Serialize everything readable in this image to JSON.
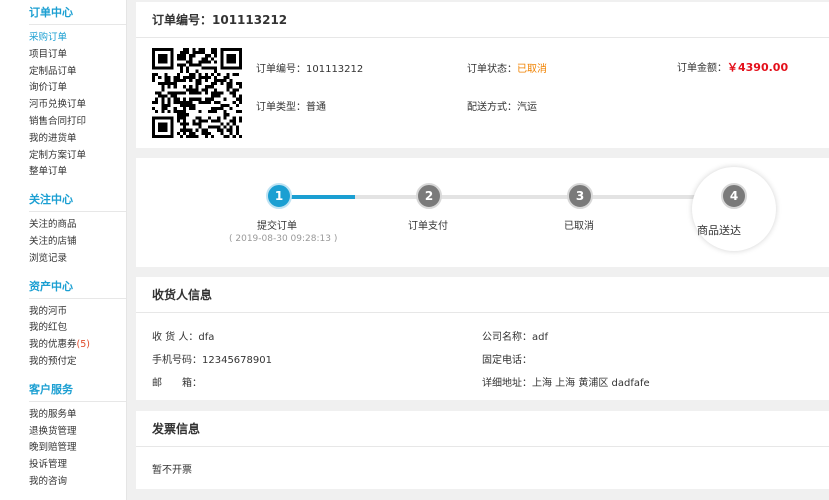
{
  "sidebar": {
    "sections": [
      {
        "title": "订单中心",
        "items": [
          "采购订单",
          "项目订单",
          "定制品订单",
          "询价订单",
          "河币兑换订单",
          "销售合同打印",
          "我的进货单",
          "定制方案订单",
          "整单订单"
        ]
      },
      {
        "title": "关注中心",
        "items": [
          "关注的商品",
          "关注的店铺",
          "浏览记录"
        ]
      },
      {
        "title": "资产中心",
        "items": [
          "我的河币",
          "我的红包",
          "我的优惠券",
          "我的预付定"
        ],
        "coupon_count": "(5)"
      },
      {
        "title": "客户服务",
        "items": [
          "我的服务单",
          "退换货管理",
          "晚到赔管理",
          "投诉管理",
          "我的咨询"
        ]
      }
    ]
  },
  "order": {
    "header": "订单编号：101113212",
    "no_label": "订单编号：",
    "no_value": "101113212",
    "status_label": "订单状态：",
    "status_value": "已取消",
    "amount_label": "订单金额：",
    "amount_value": "￥4390.00",
    "type_label": "订单类型：",
    "type_value": "普通",
    "ship_label": "配送方式：",
    "ship_value": "汽运"
  },
  "progress": {
    "steps": [
      {
        "num": "1",
        "label": "提交订单",
        "time": "( 2019-08-30 09:28:13 )"
      },
      {
        "num": "2",
        "label": "订单支付"
      },
      {
        "num": "3",
        "label": "已取消"
      },
      {
        "num": "4",
        "label": "商品送达"
      }
    ]
  },
  "receiver": {
    "title": "收货人信息",
    "name_label": "收 货 人：",
    "name_value": "dfa",
    "phone_label": "手机号码：",
    "phone_value": "12345678901",
    "email_label": "邮　　箱：",
    "email_value": "",
    "company_label": "公司名称：",
    "company_value": "adf",
    "tel_label": "固定电话：",
    "tel_value": "",
    "addr_label": "详细地址：",
    "addr_value": "上海 上海 黄浦区 dadfafe"
  },
  "invoice": {
    "title": "发票信息",
    "text": "暂不开票"
  },
  "colors": {
    "accent": "#1b9fd2",
    "orange": "#f08200",
    "price_red": "#e4101b"
  }
}
